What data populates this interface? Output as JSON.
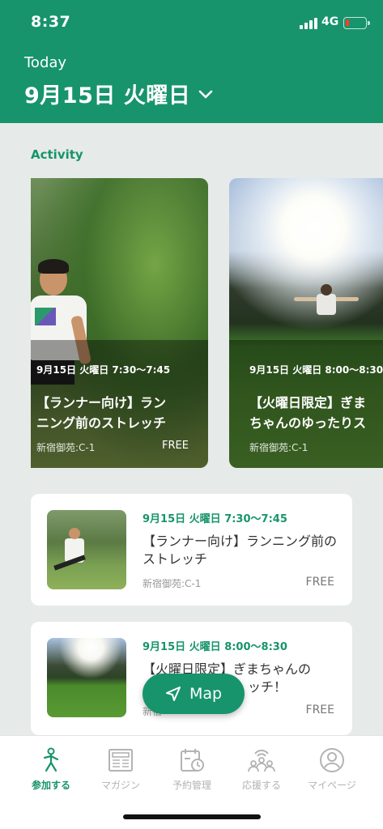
{
  "status_bar": {
    "time": "8:37",
    "network": "4G"
  },
  "header": {
    "today_label": "Today",
    "date": "9月15日 火曜日"
  },
  "section": {
    "title": "Activity"
  },
  "carousel": [
    {
      "time": "9月15日 火曜日 7:30〜7:45",
      "title_line1": "【ランナー向け】ラン",
      "title_line2": "ニング前のストレッチ",
      "location": "新宿御苑:C-1",
      "price": "FREE"
    },
    {
      "time": "9月15日 火曜日 8:00〜8:30",
      "title_line1": "【火曜日限定】ぎま",
      "title_line2": "ちゃんのゆったりス",
      "location": "新宿御苑:C-1",
      "price": "F"
    }
  ],
  "list": [
    {
      "time": "9月15日 火曜日 7:30〜7:45",
      "title": "【ランナー向け】ランニング前のストレッチ",
      "location": "新宿御苑:C-1",
      "price": "FREE"
    },
    {
      "time": "9月15日 火曜日 8:00〜8:30",
      "title": "【火曜日限定】ぎまちゃんの",
      "location": "新宿",
      "title_tail": "ッチ！",
      "price": "FREE"
    }
  ],
  "map_button": {
    "label": "Map"
  },
  "tabbar": [
    {
      "label": "参加する",
      "icon": "person-activity-icon",
      "active": true
    },
    {
      "label": "マガジン",
      "icon": "magazine-icon",
      "active": false
    },
    {
      "label": "予約管理",
      "icon": "reservation-icon",
      "active": false
    },
    {
      "label": "応援する",
      "icon": "community-icon",
      "active": false
    },
    {
      "label": "マイページ",
      "icon": "profile-icon",
      "active": false
    }
  ],
  "colors": {
    "brand": "#17946b",
    "background": "#e6eae9",
    "battery_low": "#ff3b30"
  }
}
